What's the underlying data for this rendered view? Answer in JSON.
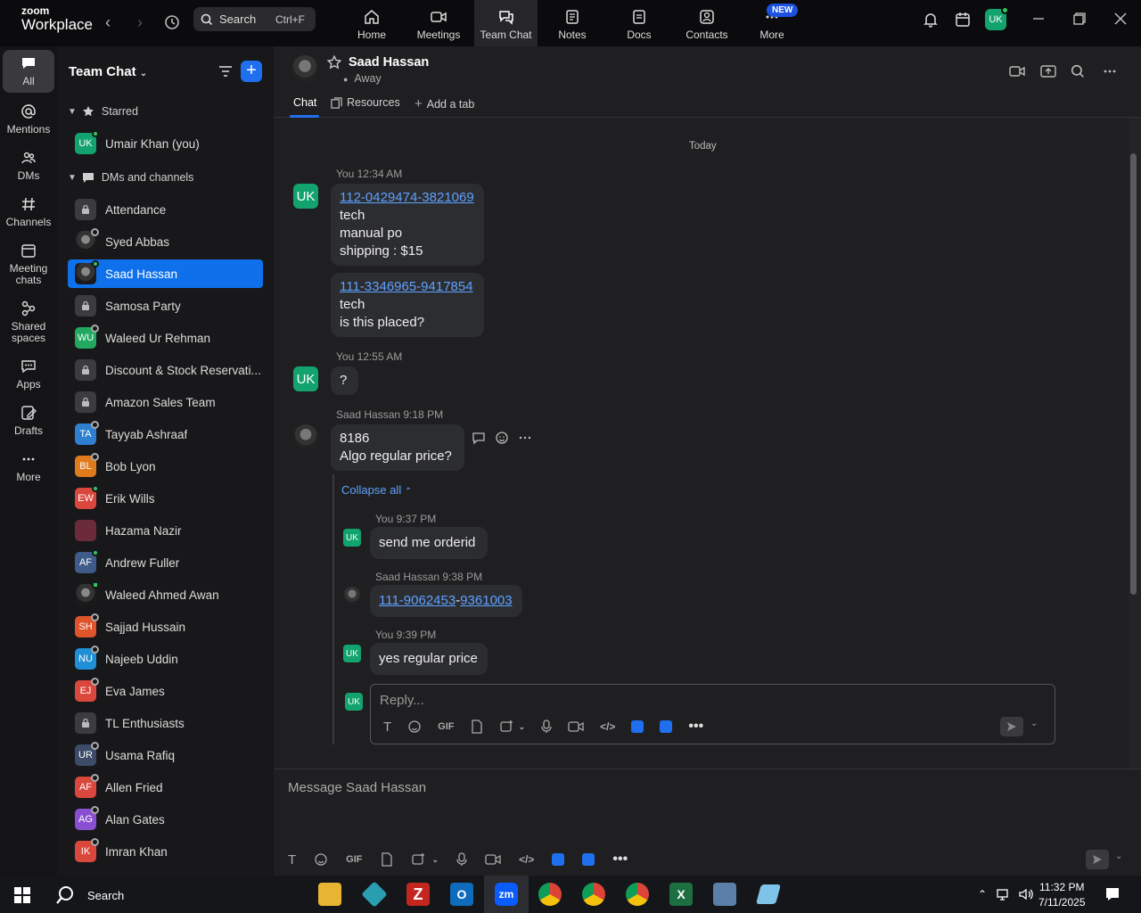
{
  "topbar": {
    "logo_line1": "zoom",
    "logo_line2": "Workplace",
    "search_label": "Search",
    "search_shortcut": "Ctrl+F",
    "tabs": [
      {
        "label": "Home",
        "icon": "home-icon"
      },
      {
        "label": "Meetings",
        "icon": "video-icon"
      },
      {
        "label": "Team Chat",
        "icon": "chat-icon",
        "active": true
      },
      {
        "label": "Notes",
        "icon": "notes-icon"
      },
      {
        "label": "Docs",
        "icon": "docs-icon"
      },
      {
        "label": "Contacts",
        "icon": "contacts-icon"
      },
      {
        "label": "More",
        "icon": "more-icon"
      }
    ],
    "new_badge": "NEW",
    "user_initials": "UK"
  },
  "rail": {
    "items": [
      {
        "label": "All",
        "icon": "chat-bubble-icon"
      },
      {
        "label": "Mentions",
        "icon": "at-icon"
      },
      {
        "label": "DMs",
        "icon": "people-icon"
      },
      {
        "label": "Channels",
        "icon": "hash-icon"
      },
      {
        "label": "Meeting chats",
        "icon": "calendar-icon"
      },
      {
        "label": "Shared spaces",
        "icon": "shared-icon"
      },
      {
        "label": "Apps",
        "icon": "apps-icon"
      },
      {
        "label": "Drafts",
        "icon": "draft-icon"
      },
      {
        "label": "More",
        "icon": "ellipsis-icon"
      }
    ]
  },
  "sidebar": {
    "title": "Team Chat",
    "starred_label": "Starred",
    "starred_item": {
      "name": "Umair Khan (you)",
      "initials": "UK"
    },
    "dms_label": "DMs and channels",
    "items": [
      {
        "name": "Attendance",
        "initials": "",
        "type": "lock"
      },
      {
        "name": "Syed Abbas",
        "initials": "",
        "type": "photo"
      },
      {
        "name": "Saad Hassan",
        "initials": "",
        "type": "photo",
        "active": true
      },
      {
        "name": "Samosa Party",
        "initials": "",
        "type": "lock"
      },
      {
        "name": "Waleed Ur Rehman",
        "initials": "WU",
        "color": "#22a861"
      },
      {
        "name": "Discount & Stock Reservati...",
        "initials": "",
        "type": "lock"
      },
      {
        "name": "Amazon Sales Team",
        "initials": "",
        "type": "lock"
      },
      {
        "name": "Tayyab Ashraaf",
        "initials": "TA",
        "color": "#2f7fd0"
      },
      {
        "name": "Bob Lyon",
        "initials": "BL",
        "color": "#e07b1d"
      },
      {
        "name": "Erik Wills",
        "initials": "EW",
        "color": "#d9473d"
      },
      {
        "name": "Hazama Nazir",
        "initials": "",
        "color": "#6b2b3a"
      },
      {
        "name": "Andrew Fuller",
        "initials": "AF",
        "color": "#3f5b8a"
      },
      {
        "name": "Waleed Ahmed Awan",
        "initials": "",
        "type": "photo"
      },
      {
        "name": "Sajjad Hussain",
        "initials": "SH",
        "color": "#e0542c"
      },
      {
        "name": "Najeeb Uddin",
        "initials": "NU",
        "color": "#1f8fd6"
      },
      {
        "name": "Eva James",
        "initials": "EJ",
        "color": "#d9473d"
      },
      {
        "name": "TL Enthusiasts",
        "initials": "",
        "type": "lock"
      },
      {
        "name": "Usama Rafiq",
        "initials": "UR",
        "color": "#3b4b68"
      },
      {
        "name": "Allen Fried",
        "initials": "AF",
        "color": "#d9473d"
      },
      {
        "name": "Alan Gates",
        "initials": "AG",
        "color": "#8a4fd0"
      },
      {
        "name": "Imran Khan",
        "initials": "IK",
        "color": "#d9473d"
      }
    ]
  },
  "chat_header": {
    "name": "Saad Hassan",
    "status": "Away",
    "tabs": [
      "Chat",
      "Resources",
      "Add a tab"
    ]
  },
  "messages": {
    "date_divider": "Today",
    "m1_meta": "You 12:34 AM",
    "m1_link": "112-0429474-3821069",
    "m1_lines": [
      "tech",
      "manual po",
      "shipping : $15"
    ],
    "m2_link": "111-3346965-9417854",
    "m2_lines": [
      "tech",
      "is this placed?"
    ],
    "m3_meta": "You 12:55 AM",
    "m3_text": "?",
    "m4_meta": "Saad Hassan 9:18 PM",
    "m4_lines": [
      "8186",
      "Algo regular price?"
    ],
    "collapse_label": "Collapse all",
    "r1_meta": "You 9:37 PM",
    "r1_text": "send me orderid",
    "r2_meta": "Saad Hassan 9:38 PM",
    "r2_link_a": "111-9062453",
    "r2_sep": "-",
    "r2_link_b": "9361003",
    "r3_meta": "You 9:39 PM",
    "r3_text": "yes regular price",
    "my_initials": "UK"
  },
  "reply": {
    "placeholder": "Reply..."
  },
  "composer": {
    "placeholder": "Message Saad Hassan"
  },
  "taskbar": {
    "search_label": "Search",
    "time": "11:32 PM",
    "date": "7/11/2025"
  }
}
